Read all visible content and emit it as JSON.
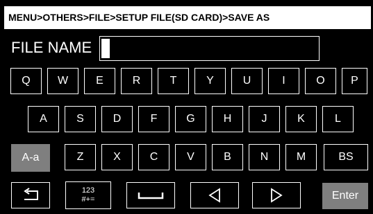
{
  "breadcrumb": "MENU>OTHERS>FILE>SETUP FILE(SD CARD)>SAVE AS",
  "file_name": {
    "label": "FILE NAME",
    "value": ""
  },
  "keyboard": {
    "row1": [
      "Q",
      "W",
      "E",
      "R",
      "T",
      "Y",
      "U",
      "I",
      "O",
      "P"
    ],
    "row2": [
      "A",
      "S",
      "D",
      "F",
      "G",
      "H",
      "J",
      "K",
      "L"
    ],
    "row3": [
      "Z",
      "X",
      "C",
      "V",
      "B",
      "N",
      "M"
    ],
    "case_toggle": "A-a",
    "backspace": "BS",
    "symbols_line1": "123",
    "symbols_line2": "#+=",
    "enter": "Enter",
    "icons": {
      "back": "return-arrow-icon",
      "space": "space-bar-icon",
      "cursor_left": "triangle-left-icon",
      "cursor_right": "triangle-right-icon"
    }
  },
  "colors": {
    "background": "#000000",
    "foreground": "#ffffff",
    "inactive_key": "#7f7f7f"
  }
}
